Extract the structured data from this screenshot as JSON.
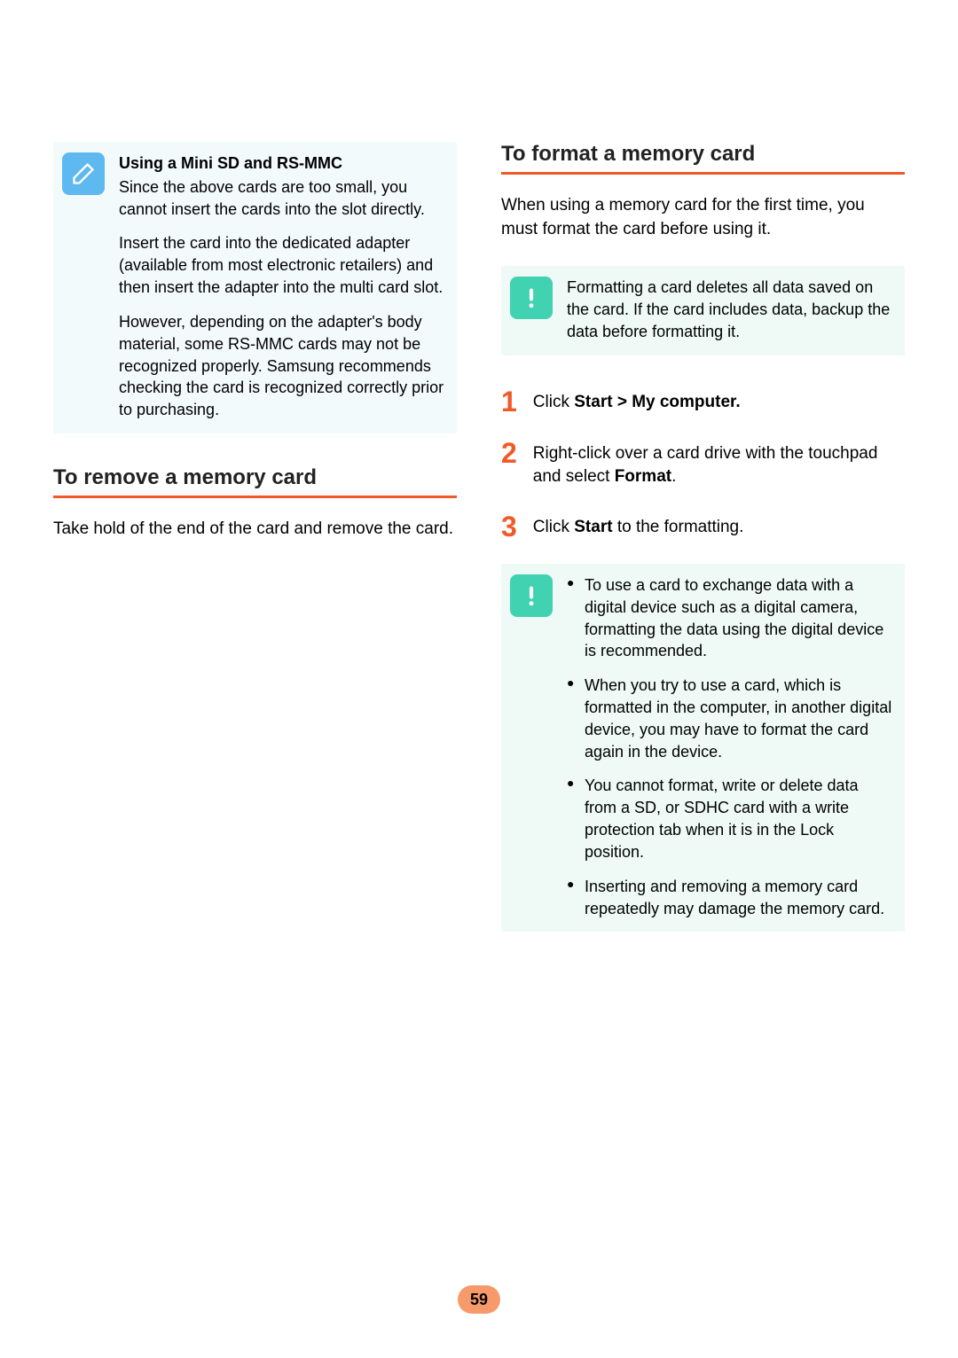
{
  "left": {
    "note": {
      "title": "Using a Mini SD and RS-MMC",
      "p1": "Since the above cards are too small, you cannot insert the cards into the slot directly.",
      "p2": "Insert the card into the dedicated adapter (available from most electronic retailers) and then insert the adapter into the multi card slot.",
      "p3": "However, depending on the adapter's body material, some RS-MMC cards may not be recognized properly. Samsung recommends checking the card is recognized correctly prior to purchasing."
    },
    "heading": "To remove a memory card",
    "body": "Take hold of the end of the card and remove the card."
  },
  "right": {
    "heading": "To format a memory card",
    "intro": "When using a memory card for the first time, you must format the card before using it.",
    "warn1": "Formatting a card deletes all data saved on the card. If the card includes data, backup the data before formatting it.",
    "steps": {
      "s1_num": "1",
      "s1_pre": "Click ",
      "s1_bold": "Start > My computer.",
      "s2_num": "2",
      "s2_a": "Right-click over a card drive with the touchpad and select ",
      "s2_b": "Format",
      "s2_c": ".",
      "s3_num": "3",
      "s3_a": "Click ",
      "s3_b": "Start",
      "s3_c": " to the formatting."
    },
    "warn2": {
      "b1": "To use a card to exchange data with a digital device such as a digital camera, formatting the data using the digital device is recommended.",
      "b2": "When you try to use a card, which is formatted in the computer, in another digital device, you may have to format the card again in the device.",
      "b3": "You cannot format, write or delete data from a SD, or SDHC card with a write protection tab when it is in the Lock position.",
      "b4": "Inserting and removing a memory card repeatedly may damage the memory card."
    }
  },
  "page_number": "59"
}
